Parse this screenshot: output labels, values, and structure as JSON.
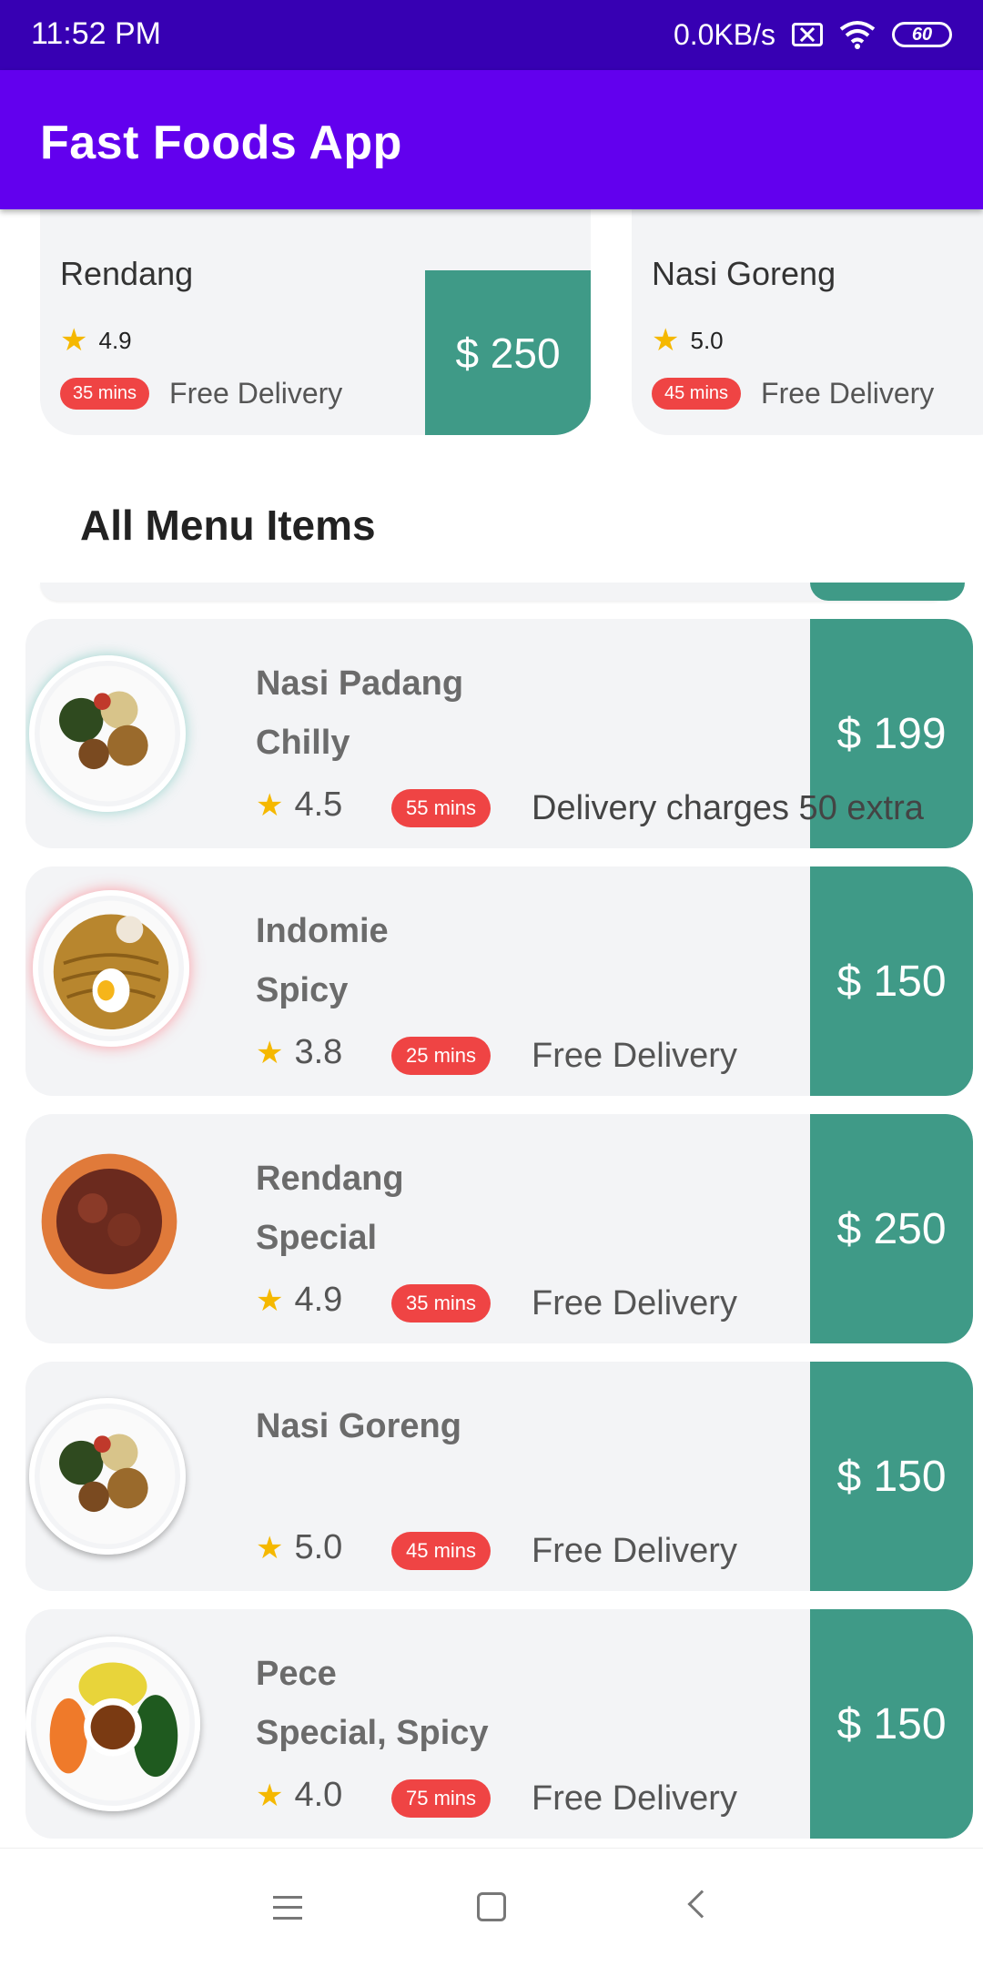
{
  "status_bar": {
    "time": "11:52 PM",
    "network_speed": "0.0KB/s",
    "battery": "60"
  },
  "app_bar": {
    "title": "Fast Foods App"
  },
  "top_cards": [
    {
      "name": "Rendang",
      "rating": "4.9",
      "mins": "35 mins",
      "delivery": "Free Delivery",
      "price": "$ 250"
    },
    {
      "name": "Nasi Goreng",
      "rating": "5.0",
      "mins": "45 mins",
      "delivery": "Free Delivery",
      "price": ""
    }
  ],
  "section_title": "All Menu Items",
  "menu_items": [
    {
      "name": "Nasi Padang",
      "subtitle": "Chilly",
      "rating": "4.5",
      "mins": "55 mins",
      "delivery": "Delivery charges 50 extra",
      "price": "$ 199",
      "image_icon": "nasi-padang-plate-icon"
    },
    {
      "name": "Indomie",
      "subtitle": "Spicy",
      "rating": "3.8",
      "mins": "25 mins",
      "delivery": "Free Delivery",
      "price": "$ 150",
      "image_icon": "noodle-bowl-icon"
    },
    {
      "name": "Rendang",
      "subtitle": "Special",
      "rating": "4.9",
      "mins": "35 mins",
      "delivery": "Free Delivery",
      "price": "$ 250",
      "image_icon": "rendang-plate-icon"
    },
    {
      "name": "Nasi Goreng",
      "subtitle": "",
      "rating": "5.0",
      "mins": "45 mins",
      "delivery": "Free Delivery",
      "price": "$ 150",
      "image_icon": "nasi-goreng-plate-icon"
    },
    {
      "name": "Pece",
      "subtitle": "Special, Spicy",
      "rating": "4.0",
      "mins": "75 mins",
      "delivery": "Free Delivery",
      "price": "$ 150",
      "image_icon": "pecel-plate-icon"
    }
  ],
  "colors": {
    "status_bar": "#3700b3",
    "app_bar": "#6200ee",
    "price_block": "#3f9a87",
    "badge": "#ef4444",
    "star": "#f5b800",
    "card_bg": "#f3f4f6"
  },
  "nav_icons": [
    "menu-icon",
    "home-icon",
    "back-icon"
  ]
}
